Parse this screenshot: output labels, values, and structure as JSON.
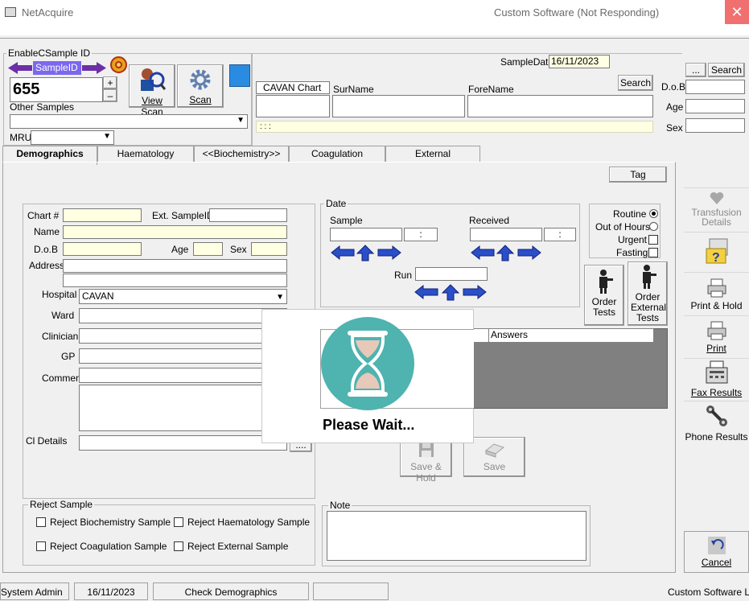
{
  "titlebar": {
    "app_title": "NetAcquire",
    "window_title": "Custom Software (Not Responding)",
    "close": "✕"
  },
  "sample": {
    "group_title": "EnableCSample ID",
    "sample_id_label": "SampleID",
    "sample_id_value": "655",
    "plus": "+",
    "minus": "–",
    "view_scan": "View Scan",
    "scan": "Scan",
    "other_samples": "Other Samples",
    "mru": "MRU",
    "sample_date_label": "SampleDate",
    "sample_date_value": "16/11/2023"
  },
  "search": {
    "chart_header": "CAVAN Chart #",
    "surname_label": "SurName",
    "forename_label": "ForeName",
    "search_btn": "Search",
    "search_btn2": "Search",
    "ellipsis_btn": "...",
    "dob_label": "D.o.B",
    "age_label": "Age",
    "sex_label": "Sex",
    "hint": ": : :"
  },
  "tabs": [
    "Demographics",
    "Haematology",
    "<<Biochemistry>>",
    "Coagulation",
    "External"
  ],
  "tag_btn": "Tag",
  "demographics": {
    "chart_label": "Chart #",
    "ext_sample_label": "Ext. SampleID",
    "name_label": "Name",
    "dob_label": "D.o.B",
    "age_label": "Age",
    "sex_label": "Sex",
    "address_label": "Address",
    "hospital_label": "Hospital",
    "hospital_value": "CAVAN",
    "ward_label": "Ward",
    "clinician_label": "Clinician",
    "gp_label": "GP",
    "comment_label": "Comment",
    "cl_details_label": "Cl Details",
    "ellipsis": "...."
  },
  "date": {
    "group_title": "Date",
    "sample_label": "Sample",
    "received_label": "Received",
    "run_label": "Run",
    "colon": ":"
  },
  "priority": {
    "routine": "Routine",
    "out_of_hours": "Out of Hours",
    "urgent": "Urgent",
    "fasting": "Fasting"
  },
  "order": {
    "order_tests": "Order Tests",
    "order_external": "Order External Tests"
  },
  "answers_header": "Answers",
  "save_hold": "Save & Hold",
  "save": "Save",
  "please_wait": "Please Wait...",
  "reject": {
    "group_title": "Reject Sample",
    "biochem": "Reject Biochemistry Sample",
    "haem": "Reject Haematology Sample",
    "coag": "Reject Coagulation Sample",
    "external": "Reject External Sample"
  },
  "note_title": "Note",
  "side": {
    "transfusion": "Transfusion Details",
    "print_hold": "Print & Hold",
    "print": "Print",
    "fax": "Fax Results",
    "phone": "Phone Results",
    "cancel": "Cancel"
  },
  "status": {
    "user": "System Admin",
    "date": "16/11/2023",
    "message": "Check Demographics",
    "company": "Custom Software Ltd"
  },
  "colors": {
    "accent": "#7b68ee",
    "arrow_blue": "#1f3fa8",
    "wait_teal": "#4fb3b0",
    "yellow_field": "#ffffe1"
  }
}
